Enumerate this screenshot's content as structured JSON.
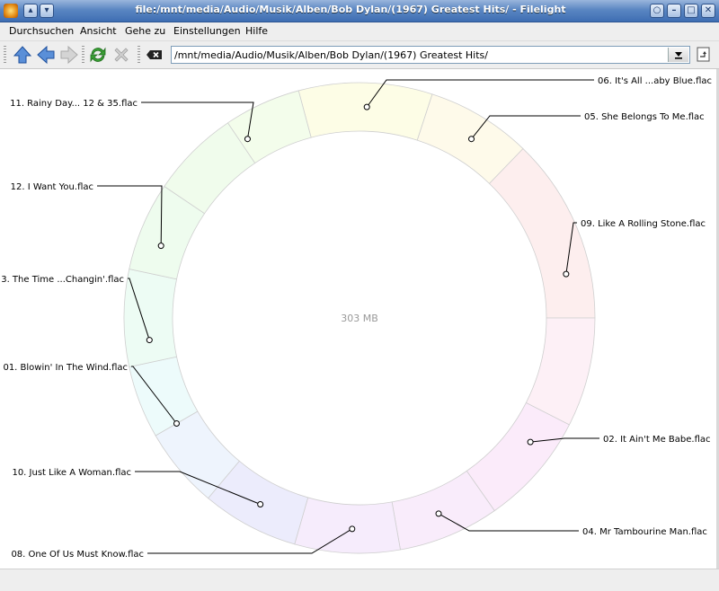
{
  "window": {
    "title": "file:/mnt/media/Audio/Musik/Alben/Bob Dylan/(1967) Greatest Hits/ - Filelight",
    "title_buttons": [
      "◂",
      "▴",
      "▾"
    ],
    "controls": [
      "○",
      "–",
      "□",
      "✕"
    ]
  },
  "menubar": {
    "items": [
      "Durchsuchen",
      "Ansicht",
      "Gehe zu",
      "Einstellungen",
      "Hilfe"
    ]
  },
  "toolbar": {
    "url": "/mnt/media/Audio/Musik/Alben/Bob Dylan/(1967) Greatest Hits/"
  },
  "chart_data": {
    "type": "pie",
    "center_label": "303 MB",
    "segments": [
      {
        "name": "06. It's All ...aby Blue.flac",
        "color": "#fdfde6"
      },
      {
        "name": "05. She Belongs To Me.flac",
        "color": "#fefaea"
      },
      {
        "name": "09. Like A Rolling Stone.flac",
        "color": "#fdeeee"
      },
      {
        "name": "",
        "color": "#fdf0f6"
      },
      {
        "name": "02. It Ain't Me Babe.flac",
        "color": "#fbebfa"
      },
      {
        "name": "",
        "color": "#f9ecfb"
      },
      {
        "name": "04. Mr Tambourine Man.flac",
        "color": "#f6ecfc"
      },
      {
        "name": "08. One Of Us Must Know.flac",
        "color": "#ececfc"
      },
      {
        "name": "10. Just Like A Woman.flac",
        "color": "#eef4fd"
      },
      {
        "name": "01. Blowin' In The Wind.flac",
        "color": "#edfbfb"
      },
      {
        "name": "3. The Time ...Changin'.flac",
        "color": "#edfcf4"
      },
      {
        "name": "12. I Want You.flac",
        "color": "#eefcee"
      },
      {
        "name": "",
        "color": "#f0fcec"
      },
      {
        "name": "11. Rainy Day... 12 & 35.flac",
        "color": "#f3fdeb"
      }
    ]
  }
}
